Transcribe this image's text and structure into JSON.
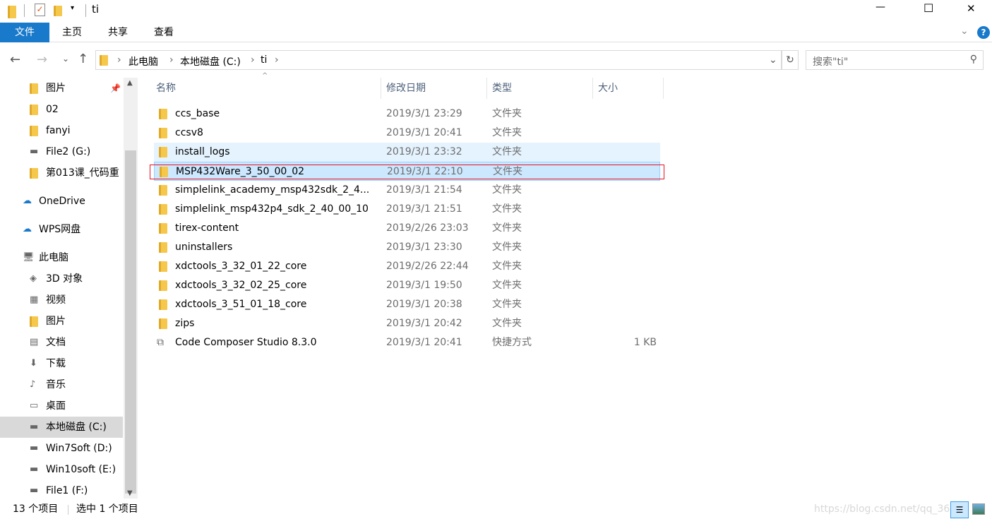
{
  "window": {
    "title": "ti",
    "minimize": "—",
    "maximize": "☐",
    "close": "✕"
  },
  "ribbon": {
    "tabs": [
      "文件",
      "主页",
      "共享",
      "查看"
    ],
    "help": "?"
  },
  "address": {
    "crumbs": [
      "此电脑",
      "本地磁盘 (C:)",
      "ti"
    ],
    "search_placeholder": "搜索\"ti\""
  },
  "nav": {
    "items": [
      {
        "label": "图片",
        "icon": "pictures-icon",
        "pinned": true
      },
      {
        "label": "02",
        "icon": "folder-icon"
      },
      {
        "label": "fanyi",
        "icon": "folder-icon"
      },
      {
        "label": "File2 (G:)",
        "icon": "drive-icon"
      },
      {
        "label": "第013课_代码重",
        "icon": "folder-icon"
      },
      {
        "label": "OneDrive",
        "icon": "cloud-icon"
      },
      {
        "label": "WPS网盘",
        "icon": "cloud-icon"
      },
      {
        "label": "此电脑",
        "icon": "computer-icon"
      },
      {
        "label": "3D 对象",
        "icon": "3d-icon"
      },
      {
        "label": "视频",
        "icon": "video-icon"
      },
      {
        "label": "图片",
        "icon": "pictures-icon"
      },
      {
        "label": "文档",
        "icon": "documents-icon"
      },
      {
        "label": "下载",
        "icon": "download-icon"
      },
      {
        "label": "音乐",
        "icon": "music-icon"
      },
      {
        "label": "桌面",
        "icon": "desktop-icon"
      },
      {
        "label": "本地磁盘 (C:)",
        "icon": "drive-icon",
        "selected": true
      },
      {
        "label": "Win7Soft (D:)",
        "icon": "drive-icon"
      },
      {
        "label": "Win10soft (E:)",
        "icon": "drive-icon"
      },
      {
        "label": "File1 (F:)",
        "icon": "drive-icon"
      }
    ]
  },
  "columns": [
    "名称",
    "修改日期",
    "类型",
    "大小"
  ],
  "files": [
    {
      "name": "ccs_base",
      "date": "2019/3/1 23:29",
      "type": "文件夹",
      "size": ""
    },
    {
      "name": "ccsv8",
      "date": "2019/3/1 20:41",
      "type": "文件夹",
      "size": ""
    },
    {
      "name": "install_logs",
      "date": "2019/3/1 23:32",
      "type": "文件夹",
      "size": ""
    },
    {
      "name": "MSP432Ware_3_50_00_02",
      "date": "2019/3/1 22:10",
      "type": "文件夹",
      "size": ""
    },
    {
      "name": "simplelink_academy_msp432sdk_2_4...",
      "date": "2019/3/1 21:54",
      "type": "文件夹",
      "size": ""
    },
    {
      "name": "simplelink_msp432p4_sdk_2_40_00_10",
      "date": "2019/3/1 21:51",
      "type": "文件夹",
      "size": ""
    },
    {
      "name": "tirex-content",
      "date": "2019/2/26 23:03",
      "type": "文件夹",
      "size": ""
    },
    {
      "name": "uninstallers",
      "date": "2019/3/1 23:30",
      "type": "文件夹",
      "size": ""
    },
    {
      "name": "xdctools_3_32_01_22_core",
      "date": "2019/2/26 22:44",
      "type": "文件夹",
      "size": ""
    },
    {
      "name": "xdctools_3_32_02_25_core",
      "date": "2019/3/1 19:50",
      "type": "文件夹",
      "size": ""
    },
    {
      "name": "xdctools_3_51_01_18_core",
      "date": "2019/3/1 20:38",
      "type": "文件夹",
      "size": ""
    },
    {
      "name": "zips",
      "date": "2019/3/1 20:42",
      "type": "文件夹",
      "size": ""
    },
    {
      "name": "Code Composer Studio 8.3.0",
      "date": "2019/3/1 20:41",
      "type": "快捷方式",
      "size": "1 KB"
    }
  ],
  "status": {
    "count": "13 个项目",
    "selected": "选中 1 个项目"
  },
  "watermark": "https://blog.csdn.net/qq_36...",
  "colors": {
    "accent": "#1979ca",
    "selection": "#cce8ff",
    "hover": "#e5f3ff",
    "highlight_box": "#e81123"
  }
}
